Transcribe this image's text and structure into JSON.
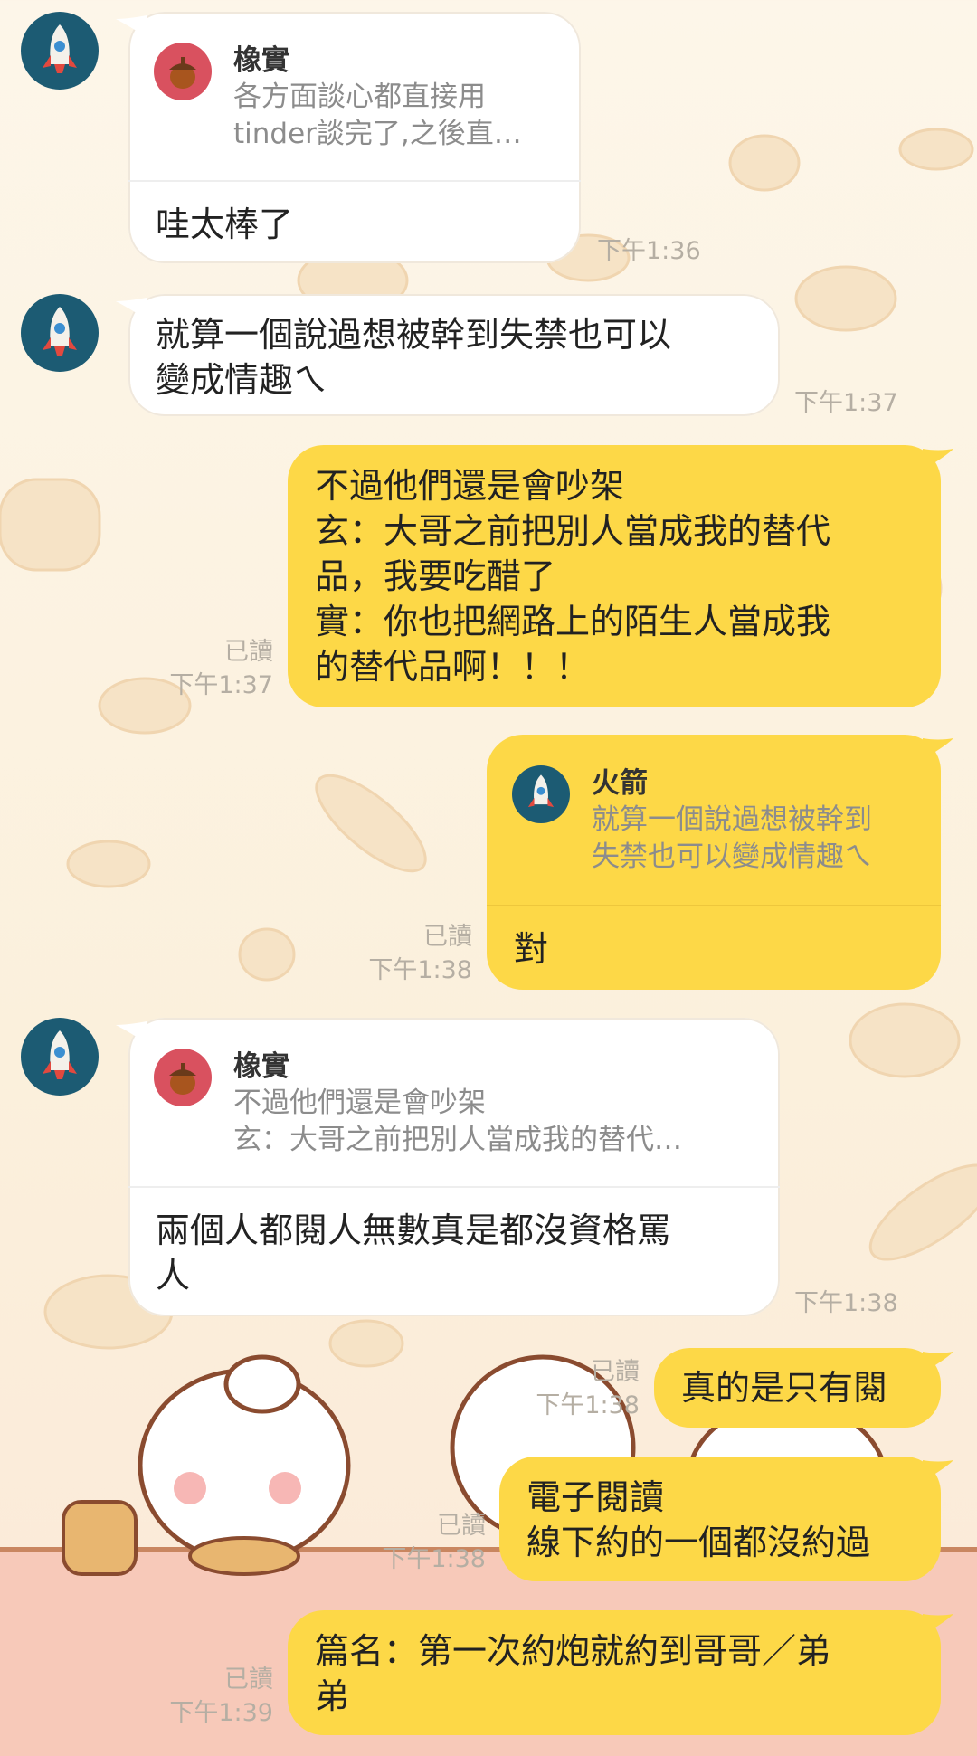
{
  "colors": {
    "incoming_bubble": "#ffffff",
    "outgoing_bubble": "#fdd847",
    "avatar_bg": "#1c5b73",
    "acorn_bg": "#d9515f",
    "meta_text": "#b5aea3"
  },
  "messages": [
    {
      "id": "m1",
      "direction": "incoming",
      "avatar": "rocket-icon",
      "quote": {
        "name": "橡實",
        "icon": "acorn-icon",
        "text": "各方面談心都直接用\ntinder談完了,之後直…"
      },
      "text": "哇太棒了",
      "time": "下午1:36"
    },
    {
      "id": "m2",
      "direction": "incoming",
      "avatar": "rocket-icon",
      "text": "就算一個說過想被幹到失禁也可以\n變成情趣ㄟ",
      "time": "下午1:37"
    },
    {
      "id": "m3",
      "direction": "outgoing",
      "text": "不過他們還是會吵架\n玄：大哥之前把別人當成我的替代\n品，我要吃醋了\n實：你也把網路上的陌生人當成我\n的替代品啊！！！",
      "read": "已讀",
      "time": "下午1:37"
    },
    {
      "id": "m4",
      "direction": "outgoing",
      "quote": {
        "name": "火箭",
        "icon": "rocket-icon",
        "text": "就算一個說過想被幹到\n失禁也可以變成情趣ㄟ"
      },
      "text": "對",
      "read": "已讀",
      "time": "下午1:38"
    },
    {
      "id": "m5",
      "direction": "incoming",
      "avatar": "rocket-icon",
      "quote": {
        "name": "橡實",
        "icon": "acorn-icon",
        "text": "不過他們還是會吵架\n玄：大哥之前把別人當成我的替代…"
      },
      "text": "兩個人都閱人無數真是都沒資格罵\n人",
      "time": "下午1:38"
    },
    {
      "id": "m6",
      "direction": "outgoing",
      "text": "真的是只有閱",
      "read": "已讀",
      "time": "下午1:38"
    },
    {
      "id": "m7",
      "direction": "outgoing",
      "text": "電子閱讀\n線下約的一個都沒約過",
      "read": "已讀",
      "time": "下午1:38"
    },
    {
      "id": "m8",
      "direction": "outgoing",
      "text": "篇名：第一次約炮就約到哥哥／弟\n弟",
      "read": "已讀",
      "time": "下午1:39"
    }
  ]
}
